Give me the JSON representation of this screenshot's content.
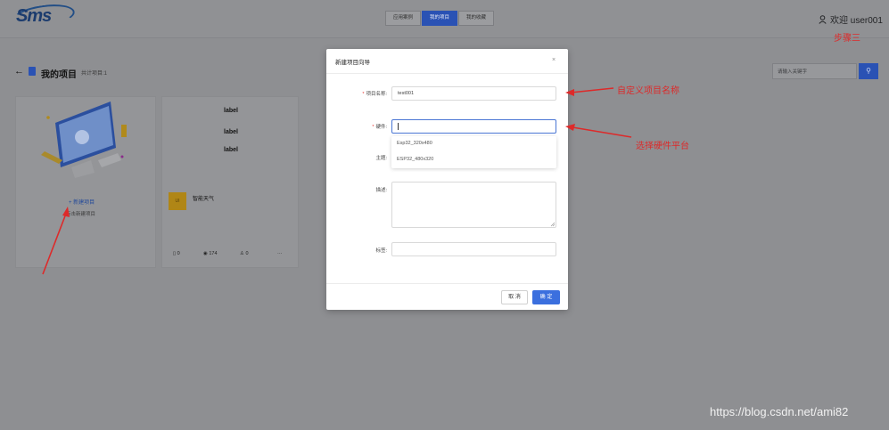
{
  "header": {
    "logo_text": "Sms",
    "tabs": [
      {
        "label": "应用案例",
        "active": false
      },
      {
        "label": "我的项目",
        "active": true
      },
      {
        "label": "我的收藏",
        "active": false
      }
    ],
    "user_label": "欢迎 user001"
  },
  "page": {
    "title": "我的项目",
    "count_label": "共计项目:1",
    "search_placeholder": "请输入关键字"
  },
  "cards": {
    "new_project": {
      "label": "+ 新建项目",
      "sub": "点击新建项目"
    },
    "project": {
      "labels": [
        "label",
        "label",
        "label"
      ],
      "thumb_text": "UI",
      "name": "智能天气",
      "stats": {
        "files": "0",
        "views": "174",
        "likes": "0",
        "more": "···"
      }
    }
  },
  "modal": {
    "title": "新建项目向导",
    "close": "×",
    "fields": {
      "name_label": "项目名称:",
      "name_value": "test001",
      "hardware_label": "硬件:",
      "theme_label": "主题:",
      "desc_label": "描述:",
      "tags_label": "标签:"
    },
    "hardware_options": [
      "Esp32_320x480",
      "ESP32_480x320"
    ],
    "cancel": "取 消",
    "ok": "确 定"
  },
  "annotations": {
    "step": "步骤三",
    "custom_name": "自定义项目名称",
    "choose_hw": "选择硬件平台"
  },
  "watermark": "https://blog.csdn.net/ami82",
  "colors": {
    "accent": "#2a52b4",
    "annotation": "#dd2a2a",
    "overlay": "#8e8f92"
  }
}
